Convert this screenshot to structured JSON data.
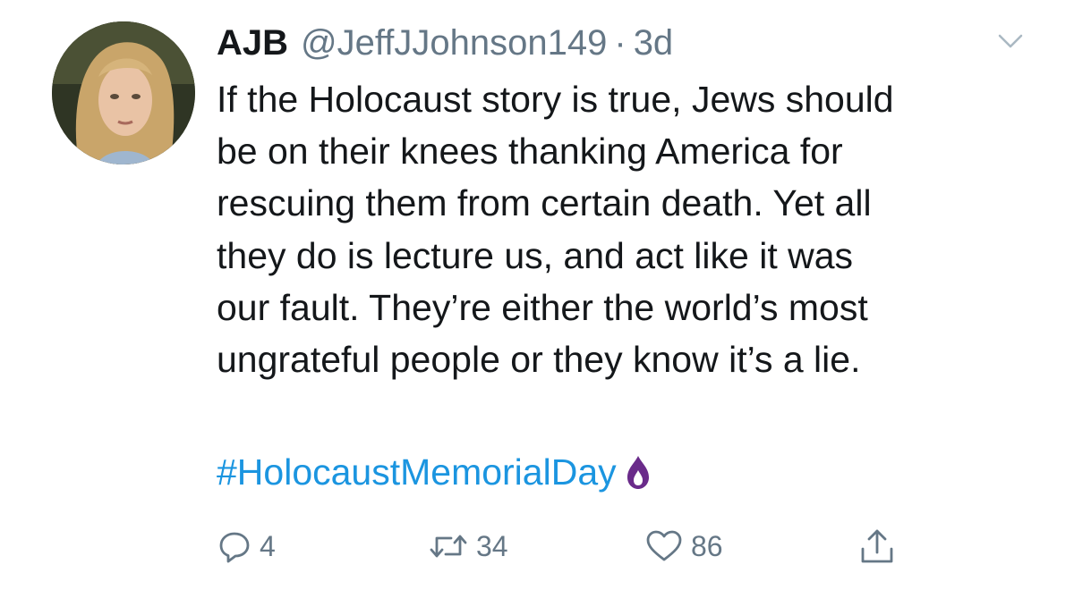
{
  "tweet": {
    "display_name": "AJB",
    "handle": "@JeffJJohnson149",
    "separator": "·",
    "time": "3d",
    "text": "If the Holocaust story is true, Jews should\nbe on their knees thanking America for\nrescuing them from certain death. Yet all\nthey do is lecture us, and act like it was\nour fault. They’re either the world’s most\nungrateful people or they know it’s a lie.",
    "hashtag": "#HolocaustMemorialDay",
    "hashtag_emoji": "purple-flame-icon"
  },
  "actions": {
    "reply_count": "4",
    "retweet_count": "34",
    "like_count": "86"
  },
  "icons": {
    "reply": "reply-icon",
    "retweet": "retweet-icon",
    "like": "heart-icon",
    "share": "share-icon",
    "menu": "chevron-down-icon"
  },
  "colors": {
    "text": "#14171a",
    "secondary": "#657786",
    "link": "#1b95e0",
    "flame": "#6a2b8a"
  }
}
